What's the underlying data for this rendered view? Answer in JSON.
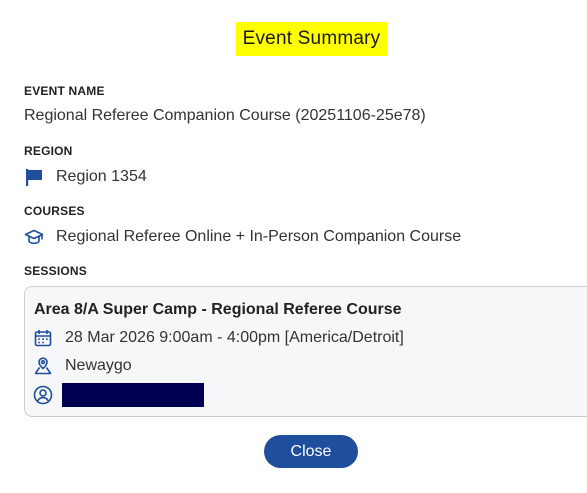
{
  "dialog": {
    "title": "Event Summary"
  },
  "event_name": {
    "label": "EVENT NAME",
    "value": "Regional Referee Companion Course (20251106-25e78)"
  },
  "region": {
    "label": "REGION",
    "value": "Region 1354",
    "icon": "flag-icon"
  },
  "courses": {
    "label": "COURSES",
    "value": "Regional Referee Online + In-Person Companion Course",
    "icon": "graduation-cap-icon"
  },
  "sessions": {
    "label": "SESSIONS",
    "items": [
      {
        "title": "Area 8/A Super Camp - Regional Referee Course",
        "datetime": "28 Mar 2026 9:00am - 4:00pm [America/Detroit]",
        "location": "Newaygo",
        "instructor_redacted": true
      }
    ]
  },
  "actions": {
    "close_label": "Close"
  },
  "colors": {
    "title_highlight": "#ffff00",
    "primary": "#1f4f9c",
    "redaction": "#000050"
  }
}
